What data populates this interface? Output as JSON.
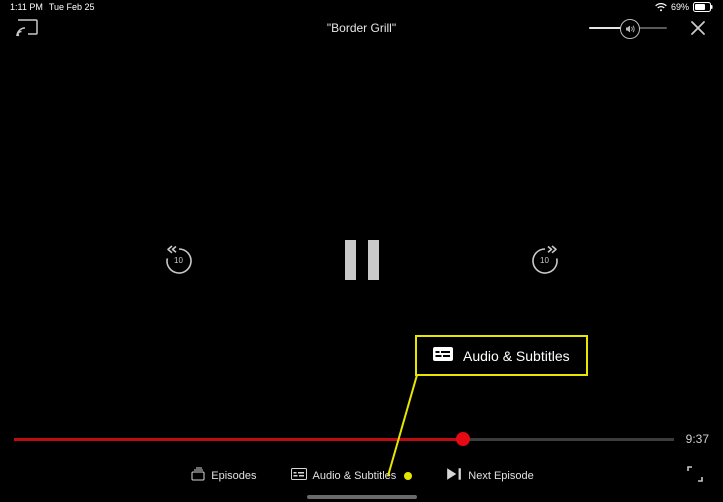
{
  "status_bar": {
    "time": "1:11 PM",
    "date": "Tue Feb 25",
    "battery_pct": "69%"
  },
  "player": {
    "title": "\"Border Grill\"",
    "volume": {
      "percent": 52
    },
    "skip_back_label": "10",
    "skip_fwd_label": "10",
    "progress": {
      "percent": 68,
      "time_remaining": "9:37"
    }
  },
  "callout": {
    "label": "Audio & Subtitles"
  },
  "bottom": {
    "episodes_label": "Episodes",
    "audio_subs_label": "Audio & Subtitles",
    "next_episode_label": "Next Episode"
  }
}
